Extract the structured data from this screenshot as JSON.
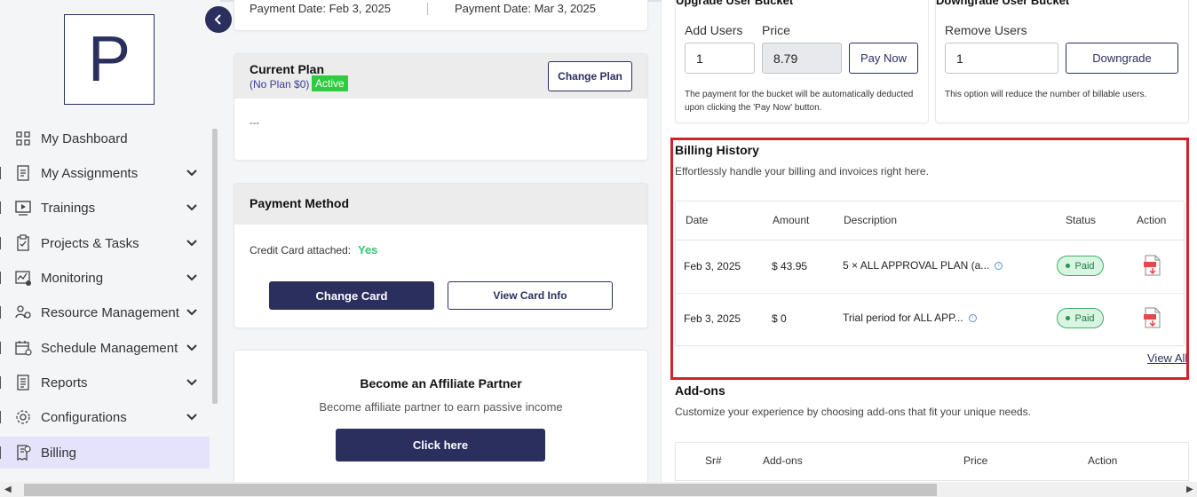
{
  "sidebar": {
    "logo_letter": "P",
    "items": [
      {
        "label": "My Dashboard",
        "icon": "grid-icon",
        "chevron": false
      },
      {
        "label": "My Assignments",
        "icon": "assignment-icon",
        "chevron": true
      },
      {
        "label": "Trainings",
        "icon": "video-icon",
        "chevron": true
      },
      {
        "label": "Projects & Tasks",
        "icon": "clipboard-icon",
        "chevron": true
      },
      {
        "label": "Monitoring",
        "icon": "monitoring-icon",
        "chevron": true
      },
      {
        "label": "Resource Management",
        "icon": "resource-icon",
        "chevron": true
      },
      {
        "label": "Schedule Management",
        "icon": "schedule-icon",
        "chevron": true
      },
      {
        "label": "Reports",
        "icon": "report-icon",
        "chevron": true
      },
      {
        "label": "Configurations",
        "icon": "gear-icon",
        "chevron": true
      },
      {
        "label": "Billing",
        "icon": "billing-icon",
        "chevron": false,
        "active": true
      }
    ]
  },
  "payment_dates": {
    "left": "Payment Date: Feb 3, 2025",
    "right": "Payment Date: Mar 3, 2025"
  },
  "current_plan": {
    "title": "Current Plan",
    "subtitle": "(No Plan $0)",
    "badge": "Active",
    "button": "Change Plan",
    "body": "---"
  },
  "payment_method": {
    "title": "Payment Method",
    "label": "Credit Card attached:",
    "value": "Yes",
    "change_button": "Change Card",
    "view_button": "View Card Info"
  },
  "affiliate": {
    "title": "Become an Affiliate Partner",
    "subtitle": "Become affiliate partner to earn passive income",
    "button": "Click here"
  },
  "upgrade": {
    "title": "Upgrade User Bucket",
    "users_label": "Add Users",
    "users_value": "1",
    "price_label": "Price",
    "price_value": "8.79",
    "button": "Pay Now",
    "note_line1": "The payment for the bucket will be automatically deducted",
    "note_line2": "upon clicking the 'Pay Now' button."
  },
  "downgrade": {
    "title": "Downgrade User Bucket",
    "users_label": "Remove Users",
    "users_value": "1",
    "button": "Downgrade",
    "note": "This option will reduce the number of billable users."
  },
  "billing_history": {
    "title": "Billing History",
    "subtitle": "Effortlessly handle your billing and invoices right here.",
    "columns": [
      "Date",
      "Amount",
      "Description",
      "Status",
      "Action"
    ],
    "rows": [
      {
        "date": "Feb 3, 2025",
        "amount": "$ 43.95",
        "description": "5 × ALL APPROVAL PLAN (a...",
        "status": "Paid"
      },
      {
        "date": "Feb 3, 2025",
        "amount": "$ 0",
        "description": "Trial period for ALL APP...",
        "status": "Paid"
      }
    ],
    "view_all": "View All"
  },
  "addons": {
    "title": "Add-ons",
    "subtitle": "Customize your experience by choosing add-ons that fit your unique needs.",
    "columns": [
      "Sr#",
      "Add-ons",
      "Price",
      "Action"
    ]
  },
  "colors": {
    "navy": "#2b2f5e",
    "highlight_red": "#d6202a",
    "paid_green": "#1f9a4f",
    "active_green": "#2ecc40"
  }
}
